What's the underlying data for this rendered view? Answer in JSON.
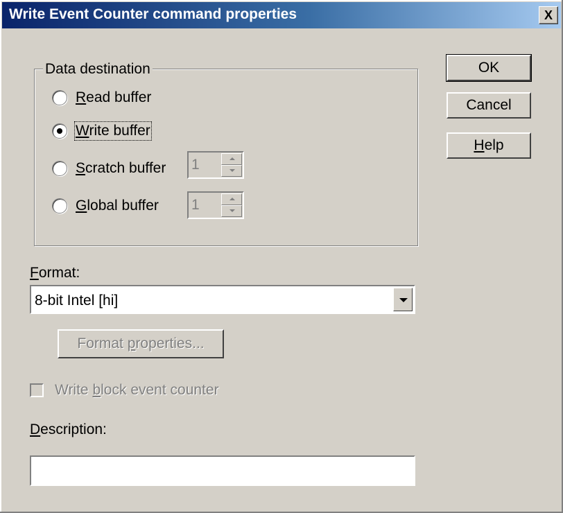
{
  "window": {
    "title": "Write Event Counter command properties",
    "close_label": "X"
  },
  "data_destination": {
    "legend": "Data destination",
    "options": [
      {
        "mnemonic": "R",
        "rest": "ead buffer",
        "selected": false
      },
      {
        "mnemonic": "W",
        "rest": "rite buffer",
        "selected": true
      },
      {
        "mnemonic": "S",
        "rest": "cratch buffer",
        "selected": false
      },
      {
        "mnemonic": "G",
        "rest": "lobal buffer",
        "selected": false
      }
    ],
    "scratch_index": "1",
    "global_index": "1"
  },
  "buttons": {
    "ok": "OK",
    "cancel": "Cancel",
    "help_mnemonic": "H",
    "help_rest": "elp"
  },
  "format": {
    "label_mnemonic": "F",
    "label_rest": "ormat:",
    "selected": "8-bit Intel  [hi]",
    "properties_pre": "Format ",
    "properties_mnemonic": "p",
    "properties_rest": "roperties..."
  },
  "write_block": {
    "pre": "Write ",
    "mnemonic": "b",
    "rest": "lock event counter",
    "checked": false
  },
  "description": {
    "label_mnemonic": "D",
    "label_rest": "escription:",
    "value": ""
  },
  "colors": {
    "face": "#d4d0c8",
    "title_start": "#0a246a",
    "title_end": "#a6caf0"
  }
}
